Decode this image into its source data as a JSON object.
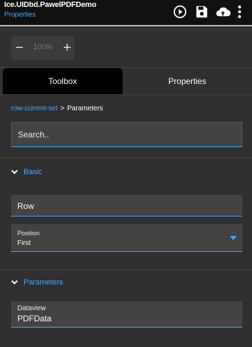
{
  "header": {
    "title": "Ice.UIDbd.PawelPDFDemo",
    "subtitle": "Properties",
    "icons": [
      "play-circle-icon",
      "save-icon",
      "cloud-upload-icon",
      "more-vert-icon"
    ]
  },
  "zoom": {
    "minus": "−",
    "value": "100%",
    "plus": "+"
  },
  "tabs": [
    {
      "label": "Toolbox",
      "active": true
    },
    {
      "label": "Properties",
      "active": false
    }
  ],
  "breadcrumb": {
    "link": "row-current-set",
    "separator": ">",
    "current": "Parameters"
  },
  "search": {
    "placeholder": "Search.."
  },
  "sections": {
    "basic": {
      "label": "Basic",
      "row_field": "Row",
      "position": {
        "label": "Position",
        "value": "First"
      }
    },
    "parameters": {
      "label": "Parameters",
      "dataview": {
        "label": "Dataview",
        "value": "PDFData"
      }
    }
  },
  "colors": {
    "accent": "#4aa6ff",
    "background": "#303030",
    "field": "#434343",
    "header": "#111111"
  }
}
